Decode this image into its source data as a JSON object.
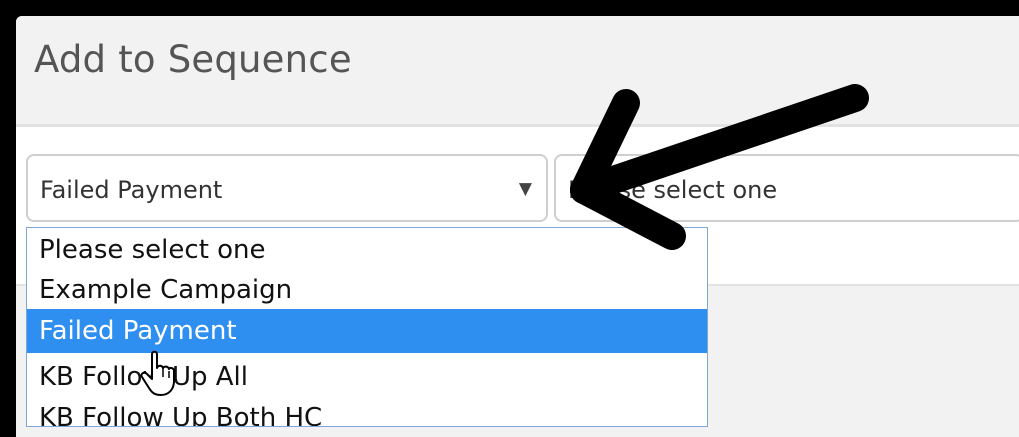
{
  "modal": {
    "title": "Add to Sequence"
  },
  "sequence_select": {
    "value": "Failed Payment",
    "caret": "▼"
  },
  "step_select": {
    "value": "Please select one"
  },
  "dropdown": {
    "options": [
      "Please select one",
      "Example Campaign",
      "Failed Payment",
      "KB Follow Up All",
      "KB Follow Up Both HC"
    ],
    "selected": "Failed Payment"
  },
  "colors": {
    "selected_option": "#2f8ff0",
    "annotation_arrow": "#000000"
  },
  "icons": {
    "annotation": "arrow-icon",
    "pointer": "hand-cursor-icon"
  }
}
